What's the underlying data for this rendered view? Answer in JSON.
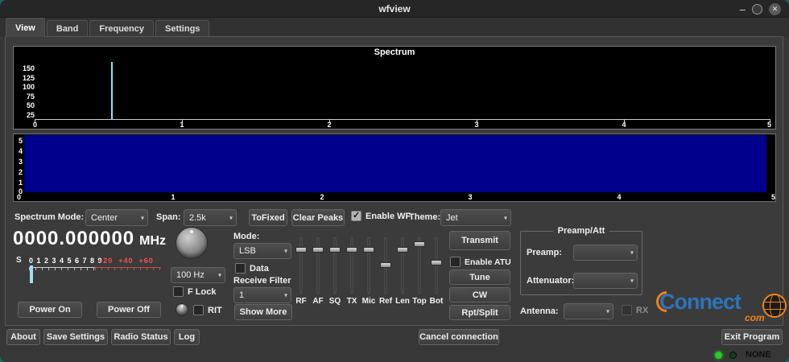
{
  "window": {
    "title": "wfview"
  },
  "icons": {
    "chevron_down": "▾",
    "minimize": "–",
    "close": "✕"
  },
  "tabs": {
    "items": [
      {
        "label": "View"
      },
      {
        "label": "Band"
      },
      {
        "label": "Frequency"
      },
      {
        "label": "Settings"
      }
    ],
    "active": "View"
  },
  "spectrum": {
    "title": "Spectrum",
    "y_ticks": [
      "150",
      "125",
      "100",
      "75",
      "50",
      "25"
    ],
    "x_ticks": [
      "0",
      "1",
      "2",
      "3",
      "4",
      "5"
    ],
    "spike": {
      "x_frac": 0.104,
      "amplitude_frac": 0.79,
      "color": "#86e7f5"
    }
  },
  "waterfall": {
    "y_ticks": [
      "5",
      "4",
      "3",
      "2",
      "1",
      "0"
    ],
    "x_ticks": [
      "0",
      "1",
      "2",
      "3",
      "4",
      "5"
    ],
    "color": "#00008c"
  },
  "controls_row": {
    "spectrum_mode_label": "Spectrum Mode:",
    "spectrum_mode": "Center",
    "span_label": "Span:",
    "span": "2.5k",
    "tofixed": "ToFixed",
    "clear_peaks": "Clear Peaks",
    "enable_wf": "Enable WF",
    "enable_wf_checked": true,
    "theme_label": "Theme:",
    "theme": "Jet"
  },
  "frequency": {
    "value": "0000.000000",
    "unit": "MHz"
  },
  "smeter": {
    "label": "S",
    "digits": "0 1 2 3 4 5 6 7 8 9",
    "plus_marks": "+20  +40  +60"
  },
  "tuning": {
    "step": "100 Hz",
    "f_lock": "F Lock",
    "rit": "RIT"
  },
  "power": {
    "on": "Power On",
    "off": "Power Off"
  },
  "mode": {
    "label": "Mode:",
    "value": "LSB",
    "data_checkbox": "Data",
    "receive_filter_label": "Receive Filter",
    "filter_value": "1",
    "show_more": "Show More"
  },
  "sliders": [
    {
      "label": "RF",
      "pos": 18
    },
    {
      "label": "AF",
      "pos": 18
    },
    {
      "label": "SQ",
      "pos": 18
    },
    {
      "label": "TX",
      "pos": 18
    },
    {
      "label": "Mic",
      "pos": 18
    },
    {
      "label": "Ref",
      "pos": 45
    },
    {
      "label": "Len",
      "pos": 18
    },
    {
      "label": "Top",
      "pos": 8
    },
    {
      "label": "Bot",
      "pos": 40
    }
  ],
  "transmit_panel": {
    "transmit": "Transmit",
    "enable_atu": "Enable ATU",
    "tune": "Tune",
    "cw": "CW",
    "rpt_split": "Rpt/Split"
  },
  "preamp_group": {
    "title": "Preamp/Att",
    "preamp_label": "Preamp:",
    "preamp_value": "",
    "attenuator_label": "Attenuator:",
    "attenuator_value": ""
  },
  "antenna": {
    "label": "Antenna:",
    "value": "",
    "rx": "RX"
  },
  "logo": {
    "text_c": "C",
    "text_rest": "onnect",
    "dot_com": "com"
  },
  "bottom_bar": {
    "about": "About",
    "save_settings": "Save Settings",
    "radio_status": "Radio Status",
    "log": "Log",
    "cancel_connection": "Cancel connection",
    "exit_program": "Exit Program"
  },
  "statusbar": {
    "connection": "NONE"
  }
}
